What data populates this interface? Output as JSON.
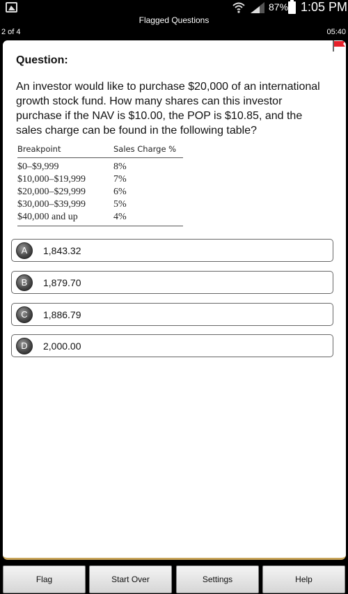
{
  "status_bar": {
    "icons": [
      "gallery-icon",
      "wifi-icon",
      "signal-icon",
      "battery-icon"
    ],
    "battery_percent": "87%",
    "time": "1:05 PM"
  },
  "header": {
    "title": "Flagged Questions",
    "progress": "2 of 4",
    "timer": "05:40",
    "flag_color": "#e8202a"
  },
  "question": {
    "heading": "Question:",
    "text": "An investor would like to purchase $20,000 of an international growth stock fund. How many shares can this investor purchase if the NAV is $10.00, the POP is $10.85, and the sales charge can be found in the following table?",
    "table": {
      "headers": [
        "Breakpoint",
        "Sales Charge %"
      ],
      "rows": [
        [
          "$0–$9,999",
          "8%"
        ],
        [
          "$10,000–$19,999",
          "7%"
        ],
        [
          "$20,000–$29,999",
          "6%"
        ],
        [
          "$30,000–$39,999",
          "5%"
        ],
        [
          "$40,000 and up",
          "4%"
        ]
      ]
    }
  },
  "answers": [
    {
      "letter": "A",
      "value": "1,843.32"
    },
    {
      "letter": "B",
      "value": "1,879.70"
    },
    {
      "letter": "C",
      "value": "1,886.79"
    },
    {
      "letter": "D",
      "value": "2,000.00"
    }
  ],
  "bottom_bar": {
    "flag": "Flag",
    "start_over": "Start Over",
    "settings": "Settings",
    "help": "Help"
  },
  "colors": {
    "card_border_accent": "#c9a55a",
    "background": "#000000"
  }
}
